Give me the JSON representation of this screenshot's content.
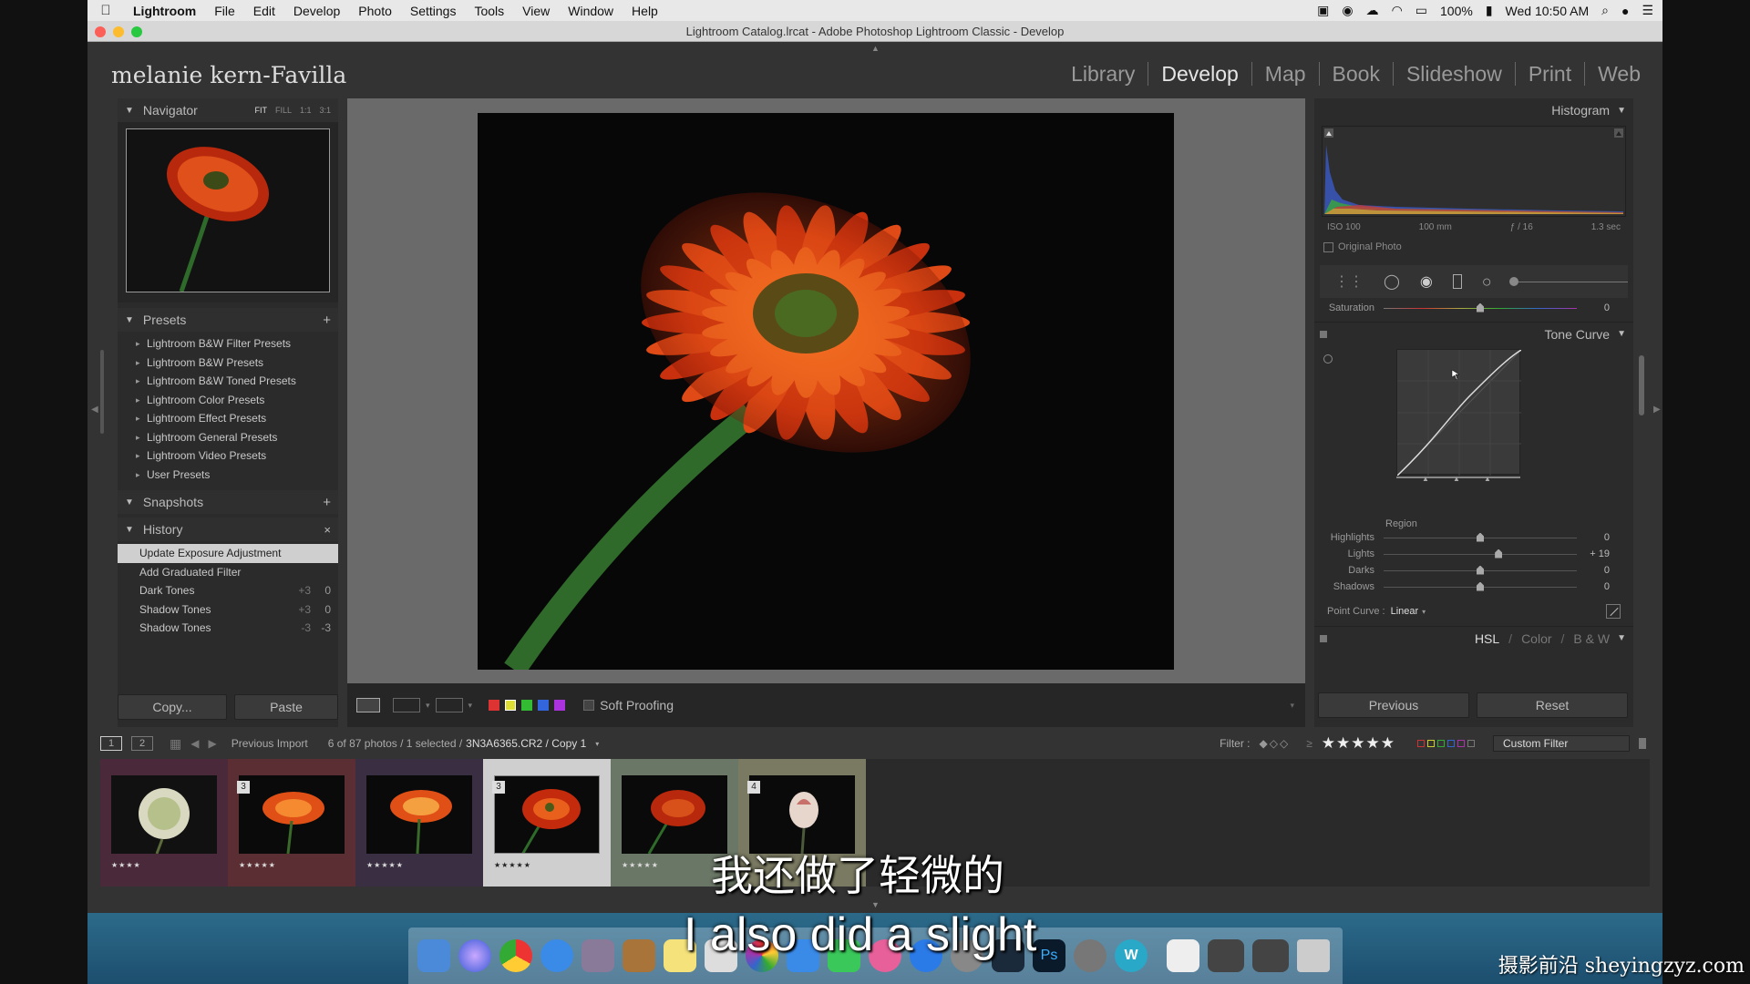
{
  "menubar": {
    "app_name": "Lightroom",
    "items": [
      "File",
      "Edit",
      "Develop",
      "Photo",
      "Settings",
      "Tools",
      "View",
      "Window",
      "Help"
    ],
    "battery": "100%",
    "clock": "Wed 10:50 AM"
  },
  "window": {
    "title": "Lightroom Catalog.lrcat - Adobe Photoshop Lightroom Classic - Develop"
  },
  "identity_plate": "melanie kern-Favilla",
  "modules": [
    "Library",
    "Develop",
    "Map",
    "Book",
    "Slideshow",
    "Print",
    "Web"
  ],
  "active_module": "Develop",
  "navigator": {
    "title": "Navigator",
    "zoom_options": [
      "FIT",
      "FILL",
      "1:1",
      "3:1"
    ]
  },
  "presets": {
    "title": "Presets",
    "items": [
      "Lightroom B&W Filter Presets",
      "Lightroom B&W Presets",
      "Lightroom B&W Toned Presets",
      "Lightroom Color Presets",
      "Lightroom Effect Presets",
      "Lightroom General Presets",
      "Lightroom Video Presets",
      "User Presets"
    ]
  },
  "snapshots": {
    "title": "Snapshots"
  },
  "history": {
    "title": "History",
    "items": [
      {
        "label": "Update Exposure Adjustment",
        "a": "",
        "b": ""
      },
      {
        "label": "Add Graduated Filter",
        "a": "",
        "b": ""
      },
      {
        "label": "Dark Tones",
        "a": "+3",
        "b": "0"
      },
      {
        "label": "Shadow Tones",
        "a": "+3",
        "b": "0"
      },
      {
        "label": "Shadow Tones",
        "a": "-3",
        "b": "-3"
      }
    ]
  },
  "left_buttons": {
    "copy": "Copy...",
    "paste": "Paste"
  },
  "toolbar": {
    "soft_proofing": "Soft Proofing"
  },
  "histogram": {
    "title": "Histogram",
    "iso": "ISO 100",
    "focal": "100 mm",
    "aperture": "ƒ / 16",
    "shutter": "1.3 sec",
    "original_photo": "Original Photo"
  },
  "saturation": {
    "label": "Saturation",
    "value": "0",
    "level": 0.5
  },
  "tone_curve": {
    "title": "Tone Curve",
    "region": "Region",
    "sliders": [
      {
        "label": "Highlights",
        "value": "0",
        "level": 0.5
      },
      {
        "label": "Lights",
        "value": "+ 19",
        "level": 0.595
      },
      {
        "label": "Darks",
        "value": "0",
        "level": 0.5
      },
      {
        "label": "Shadows",
        "value": "0",
        "level": 0.5
      }
    ],
    "point_curve_label": "Point Curve :",
    "point_curve_value": "Linear"
  },
  "hsl_tabs": [
    "HSL",
    "Color",
    "B & W"
  ],
  "right_buttons": {
    "previous": "Previous",
    "reset": "Reset"
  },
  "filmbar": {
    "source": "Previous Import",
    "count": "6 of 87 photos / 1 selected /",
    "filename": "3N3A6365.CR2 / Copy 1",
    "filter_label": "Filter :",
    "rating": "★★★★★",
    "custom_filter": "Custom Filter"
  },
  "filmstrip": [
    {
      "stars": "★★★★",
      "num": ""
    },
    {
      "stars": "★★★★★",
      "num": "3"
    },
    {
      "stars": "★★★★★",
      "num": ""
    },
    {
      "stars": "★★★★★",
      "num": "3"
    },
    {
      "stars": "★★★★★",
      "num": ""
    },
    {
      "stars": "",
      "num": "4"
    }
  ],
  "subtitles": {
    "cn": "我还做了轻微的",
    "en": "I also did a slight"
  },
  "watermark": "摄影前沿 sheyingzyz.com"
}
